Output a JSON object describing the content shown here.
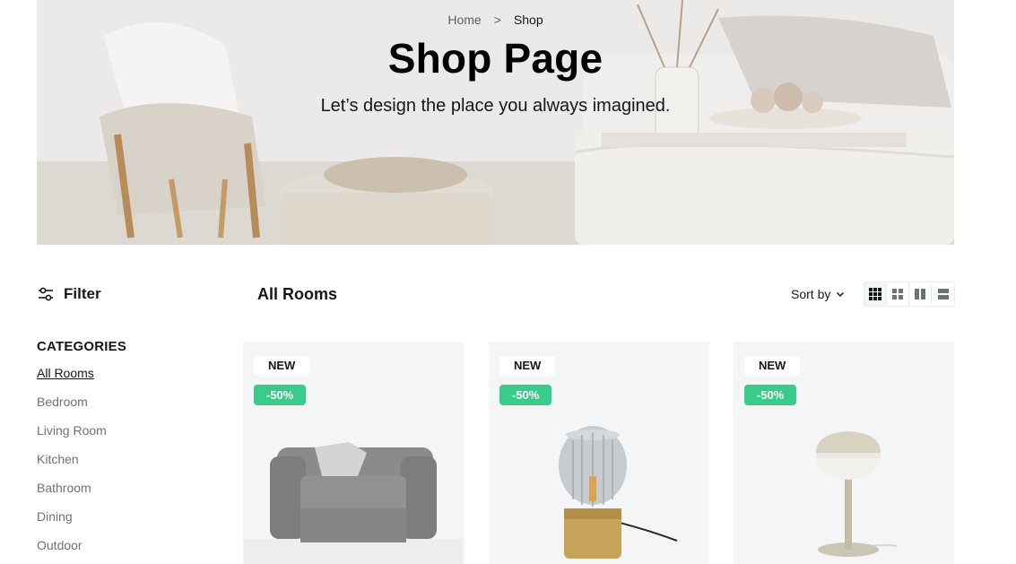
{
  "hero": {
    "breadcrumb": {
      "home": "Home",
      "separator": ">",
      "current": "Shop"
    },
    "title": "Shop Page",
    "subtitle": "Let’s design the place you always imagined."
  },
  "toolbar": {
    "filter_label": "Filter",
    "section_title": "All Rooms",
    "sort_label": "Sort by",
    "view_modes": [
      "grid-3-icon",
      "grid-2-icon",
      "columns-icon",
      "rows-icon"
    ],
    "active_view": "grid-3-icon"
  },
  "categories": {
    "heading": "CATEGORIES",
    "items": [
      {
        "label": "All Rooms",
        "active": true
      },
      {
        "label": "Bedroom",
        "active": false
      },
      {
        "label": "Living Room",
        "active": false
      },
      {
        "label": "Kitchen",
        "active": false
      },
      {
        "label": "Bathroom",
        "active": false
      },
      {
        "label": "Dining",
        "active": false
      },
      {
        "label": "Outdoor",
        "active": false
      }
    ]
  },
  "products": [
    {
      "badge_new": "NEW",
      "discount": "-50%",
      "image": "armchair-image"
    },
    {
      "badge_new": "NEW",
      "discount": "-50%",
      "image": "glass-lamp-image"
    },
    {
      "badge_new": "NEW",
      "discount": "-50%",
      "image": "table-lamp-image"
    }
  ],
  "colors": {
    "accent_green": "#38CB89",
    "text_dark": "#141718",
    "text_muted": "#6C7275",
    "card_bg": "#F3F5F7"
  }
}
